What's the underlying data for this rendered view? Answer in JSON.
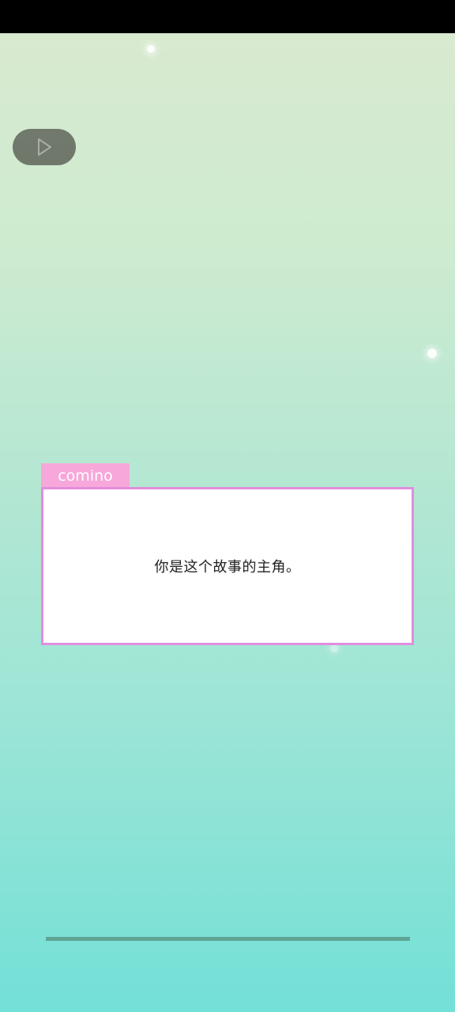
{
  "scene": {
    "colors": {
      "background_top": "#daead0",
      "background_bottom": "#73e0d7",
      "name_tab": "#f7a7da",
      "dialog_border": "#e28ddd",
      "progress_bar": "#5ea596"
    }
  },
  "controls": {
    "play_icon": "play-icon"
  },
  "dialog": {
    "speaker": "comino",
    "text": "你是这个故事的主角。"
  }
}
